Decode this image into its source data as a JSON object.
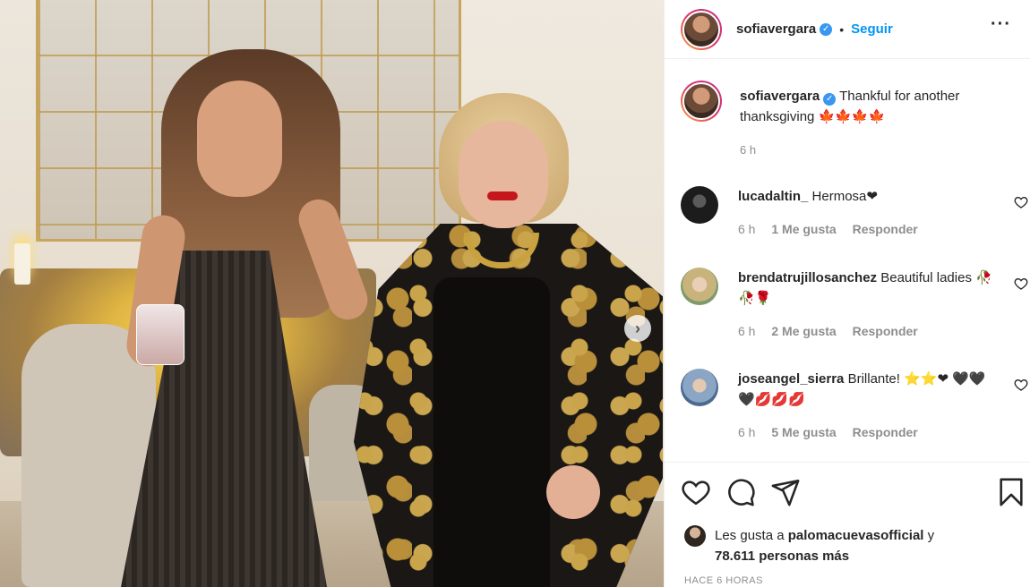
{
  "post": {
    "username": "sofiavergara",
    "follow_label": "Seguir",
    "caption": "Thankful for another thanksgiving 🍁🍁🍁🍁",
    "caption_time": "6 h"
  },
  "comments": [
    {
      "username": "lucadaltin_",
      "text": "Hermosa❤",
      "time": "6 h",
      "likes": "1 Me gusta",
      "reply": "Responder",
      "avatar_color": "#1c1c1c"
    },
    {
      "username": "brendatrujillosanchez",
      "text": "Beautiful ladies 🥀🥀🌹",
      "time": "6 h",
      "likes": "2 Me gusta",
      "reply": "Responder",
      "avatar_color": "#b9a97a"
    },
    {
      "username": "joseangel_sierra",
      "text": "Brillante! ⭐⭐❤ 🖤🖤🖤💋💋💋",
      "time": "6 h",
      "likes": "5 Me gusta",
      "reply": "Responder",
      "avatar_color": "#6e8fb5"
    }
  ],
  "likes": {
    "prefix": "Les gusta a",
    "user": "palomacuevasofficial",
    "connector": "y",
    "count_text": "78.611 personas más"
  },
  "timestamp": "HACE 6 HORAS",
  "colors": {
    "link": "#0095f6",
    "verified": "#3897f0",
    "muted": "#8e8e8e"
  },
  "icons": [
    "more-options-icon",
    "verified-badge-icon",
    "heart-icon",
    "comment-icon",
    "share-icon",
    "bookmark-icon",
    "next-image-icon"
  ]
}
